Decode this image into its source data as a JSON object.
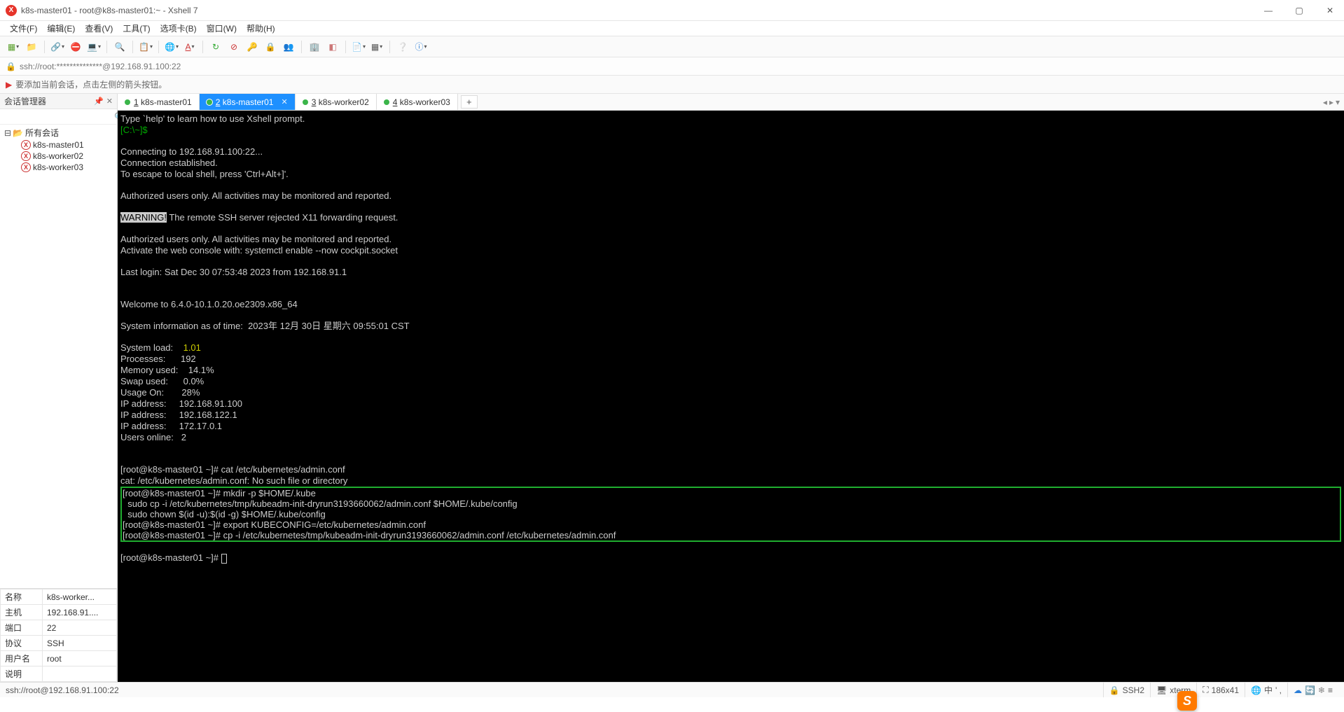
{
  "window": {
    "title": "k8s-master01 - root@k8s-master01:~ - Xshell 7"
  },
  "menu": {
    "file": "文件(F)",
    "edit": "编辑(E)",
    "view": "查看(V)",
    "tools": "工具(T)",
    "tabs": "选项卡(B)",
    "window": "窗口(W)",
    "help": "帮助(H)"
  },
  "address": "ssh://root:**************@192.168.91.100:22",
  "hint": "要添加当前会话，点击左侧的箭头按钮。",
  "sidebar": {
    "title": "会话管理器",
    "root": "所有会话",
    "items": [
      "k8s-master01",
      "k8s-worker02",
      "k8s-worker03"
    ]
  },
  "props": {
    "name_k": "名称",
    "name_v": "k8s-worker...",
    "host_k": "主机",
    "host_v": "192.168.91....",
    "port_k": "端口",
    "port_v": "22",
    "proto_k": "协议",
    "proto_v": "SSH",
    "user_k": "用户名",
    "user_v": "root",
    "desc_k": "说明",
    "desc_v": ""
  },
  "tabs": [
    {
      "num": "1",
      "label": "k8s-master01",
      "active": false
    },
    {
      "num": "2",
      "label": "k8s-master01",
      "active": true
    },
    {
      "num": "3",
      "label": "k8s-worker02",
      "active": false
    },
    {
      "num": "4",
      "label": "k8s-worker03",
      "active": false
    }
  ],
  "addtab": "+",
  "term": {
    "l1": "Type `help' to learn how to use Xshell prompt.",
    "l2": "[C:\\~]$",
    "l4": "Connecting to 192.168.91.100:22...",
    "l5": "Connection established.",
    "l6": "To escape to local shell, press 'Ctrl+Alt+]'.",
    "l8": "Authorized users only. All activities may be monitored and reported.",
    "warn": "WARNING!",
    "l10": " The remote SSH server rejected X11 forwarding request.",
    "l12": "Authorized users only. All activities may be monitored and reported.",
    "l13": "Activate the web console with: systemctl enable --now cockpit.socket",
    "l15": "Last login: Sat Dec 30 07:53:48 2023 from 192.168.91.1",
    "l18": "Welcome to 6.4.0-10.1.0.20.oe2309.x86_64",
    "l20": "System information as of time:  2023年 12月 30日 星期六 09:55:01 CST",
    "s1k": "System load:    ",
    "s1v": "1.01",
    "s2": "Processes:      192",
    "s3": "Memory used:    14.1%",
    "s4": "Swap used:      0.0%",
    "s5": "Usage On:       28%",
    "s6": "IP address:     192.168.91.100",
    "s7": "IP address:     192.168.122.1",
    "s8": "IP address:     172.17.0.1",
    "s9": "Users online:   2",
    "p1": "[root@k8s-master01 ~]# ",
    "c1": "cat /etc/kubernetes/admin.conf",
    "e1": "cat: /etc/kubernetes/admin.conf: No such file or directory",
    "p2": "[root@k8s-master01 ~]# ",
    "c2": "mkdir -p $HOME/.kube",
    "c3": "  sudo cp -i /etc/kubernetes/tmp/kubeadm-init-dryrun3193660062/admin.conf $HOME/.kube/config",
    "c4": "  sudo chown $(id -u):$(id -g) $HOME/.kube/config",
    "p3": "[root@k8s-master01 ~]# ",
    "c5": "export KUBECONFIG=/etc/kubernetes/admin.conf",
    "p4": "[root@k8s-master01 ~]# ",
    "c6": "cp -i /etc/kubernetes/tmp/kubeadm-init-dryrun3193660062/admin.conf /etc/kubernetes/admin.conf",
    "p5": "[root@k8s-master01 ~]# "
  },
  "status": {
    "left": "ssh://root@192.168.91.100:22",
    "ssh": "SSH2",
    "term": "xterm",
    "size": "186x41",
    "enc1": "中",
    "enc2": "' ,"
  },
  "ime": "S"
}
